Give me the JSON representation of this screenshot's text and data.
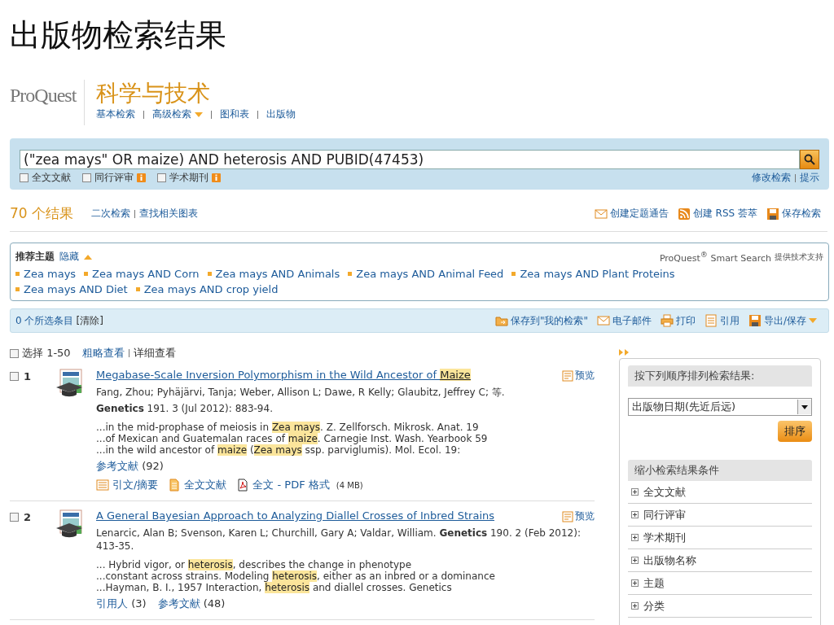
{
  "slide_title": "出版物检索结果",
  "header": {
    "logo": "ProQuest",
    "product": "科学与技术",
    "nav": [
      {
        "label": "基本检索",
        "dropdown": false
      },
      {
        "label": "高级检索",
        "dropdown": true
      },
      {
        "label": "图和表",
        "dropdown": false
      },
      {
        "label": "出版物",
        "dropdown": false
      }
    ]
  },
  "search": {
    "value": "(\"zea mays\" OR maize) AND heterosis AND PUBID(47453)",
    "filters": [
      {
        "label": "全文文献",
        "checked": false,
        "info": false
      },
      {
        "label": "同行评审",
        "checked": false,
        "info": true
      },
      {
        "label": "学术期刊",
        "checked": false,
        "info": true
      }
    ],
    "links": [
      "修改检索",
      "提示"
    ]
  },
  "results_bar": {
    "count": "70 个结果",
    "links": [
      "二次检索",
      "查找相关图表"
    ],
    "actions": [
      {
        "kind": "mail",
        "label": "创建定题通告"
      },
      {
        "kind": "rss",
        "label": "创建 RSS 荟萃"
      },
      {
        "kind": "save",
        "label": "保存检索"
      }
    ]
  },
  "suggested": {
    "title": "推荐主题",
    "toggle": "隐藏",
    "credit": "ProQuest$^{®}$ Smart Search",
    "credit_suffix": "提供技术支持",
    "topics": [
      "Zea mays",
      "Zea mays AND Corn",
      "Zea mays AND Animals",
      "Zea mays AND Animal Feed",
      "Zea mays AND Plant Proteins",
      "Zea mays AND Diet",
      "Zea mays AND crop yield"
    ]
  },
  "selection_bar": {
    "count": "0 个所选条目",
    "clear": "[清除]",
    "actions": [
      {
        "kind": "folder",
        "label": "保存到\"我的检索\"",
        "dropdown": false
      },
      {
        "kind": "mail",
        "label": "电子邮件",
        "dropdown": false
      },
      {
        "kind": "print",
        "label": "打印",
        "dropdown": false
      },
      {
        "kind": "cite",
        "label": "引用",
        "dropdown": false
      },
      {
        "kind": "save",
        "label": "导出/保存",
        "dropdown": true
      }
    ]
  },
  "list_header": {
    "checked": false,
    "select_label": "选择 1-50",
    "views": [
      {
        "label": "粗略查看",
        "selected": false
      },
      {
        "label": "详细查看",
        "selected": true
      }
    ]
  },
  "results": [
    {
      "number": "1",
      "checked": false,
      "title": [
        {
          "text": "Megabase-Scale Inversion Polymorphism in the Wild Ancestor of ",
          "highlight": false
        },
        {
          "text": "Maize",
          "highlight": true
        }
      ],
      "preview": "预览",
      "citation": [
        "Fang, Zhou; Pyhäjärvi, Tanja; Weber, Allison L; Dawe, R Kelly; Glaubitz, Jeffrey C; 等.",
        "**Genetics** 191. 3  (Jul 2012): 883-94."
      ],
      "snippets": [
        [
          {
            "text": "...in the mid-prophase of meiosis in ",
            "highlight": false
          },
          {
            "text": "Zea mays",
            "highlight": true
          },
          {
            "text": ". Z. Zellforsch. Mikrosk. Anat. 19",
            "highlight": false
          }
        ],
        [
          {
            "text": "...of Mexican and Guatemalan races of ",
            "highlight": false
          },
          {
            "text": "maize",
            "highlight": true
          },
          {
            "text": ". Carnegie Inst. Wash. Yearbook 59",
            "highlight": false
          }
        ],
        [
          {
            "text": "...in the wild ancestor of ",
            "highlight": false
          },
          {
            "text": "maize",
            "highlight": true
          },
          {
            "text": " (",
            "highlight": false
          },
          {
            "text": "Zea mays",
            "highlight": true
          },
          {
            "text": " ssp. parviglumis). Mol. Ecol. 19:",
            "highlight": false
          }
        ]
      ],
      "counts": [
        {
          "label": "参考文献",
          "value": "(92)"
        }
      ],
      "links": [
        {
          "kind": "abstract",
          "label": "引文/摘要"
        },
        {
          "kind": "fulltext",
          "label": "全文文献"
        },
        {
          "kind": "pdf",
          "label": "全文 - PDF 格式",
          "size": "(4 MB)"
        }
      ]
    },
    {
      "number": "2",
      "checked": false,
      "title": [
        {
          "text": "A General Bayesian Approach to Analyzing Diallel Crosses of Inbred Strains",
          "highlight": false
        }
      ],
      "preview": "预览",
      "citation": [
        "Lenarcic, Alan B; Svenson, Karen L; Churchill, Gary A; Valdar, William. **Genetics** 190. 2 (Feb 2012): 413-35."
      ],
      "snippets": [
        [
          {
            "text": "... Hybrid vigor, or ",
            "highlight": false
          },
          {
            "text": "heterosis",
            "highlight": true
          },
          {
            "text": ", describes the change in phenotype",
            "highlight": false
          }
        ],
        [
          {
            "text": "...constant across strains. Modeling ",
            "highlight": false
          },
          {
            "text": "heterosis",
            "highlight": true
          },
          {
            "text": ", either as an inbred or a dominance",
            "highlight": false
          }
        ],
        [
          {
            "text": "...Hayman, B. I., 1957 Interaction, ",
            "highlight": false
          },
          {
            "text": "heterosis",
            "highlight": true
          },
          {
            "text": " and diallel crosses. Genetics",
            "highlight": false
          }
        ]
      ],
      "counts": [
        {
          "label": "引用人",
          "value": "(3)"
        },
        {
          "label": "参考文献",
          "value": "(48)"
        }
      ]
    }
  ],
  "sidebar": {
    "sort_title": "按下列顺序排列检索结果:",
    "sort_value": "出版物日期(先近后远)",
    "sort_button": "排序",
    "narrow_title": "缩小检索结果条件",
    "facets": [
      "全文文献",
      "同行评审",
      "学术期刊",
      "出版物名称",
      "主题",
      "分类"
    ]
  }
}
